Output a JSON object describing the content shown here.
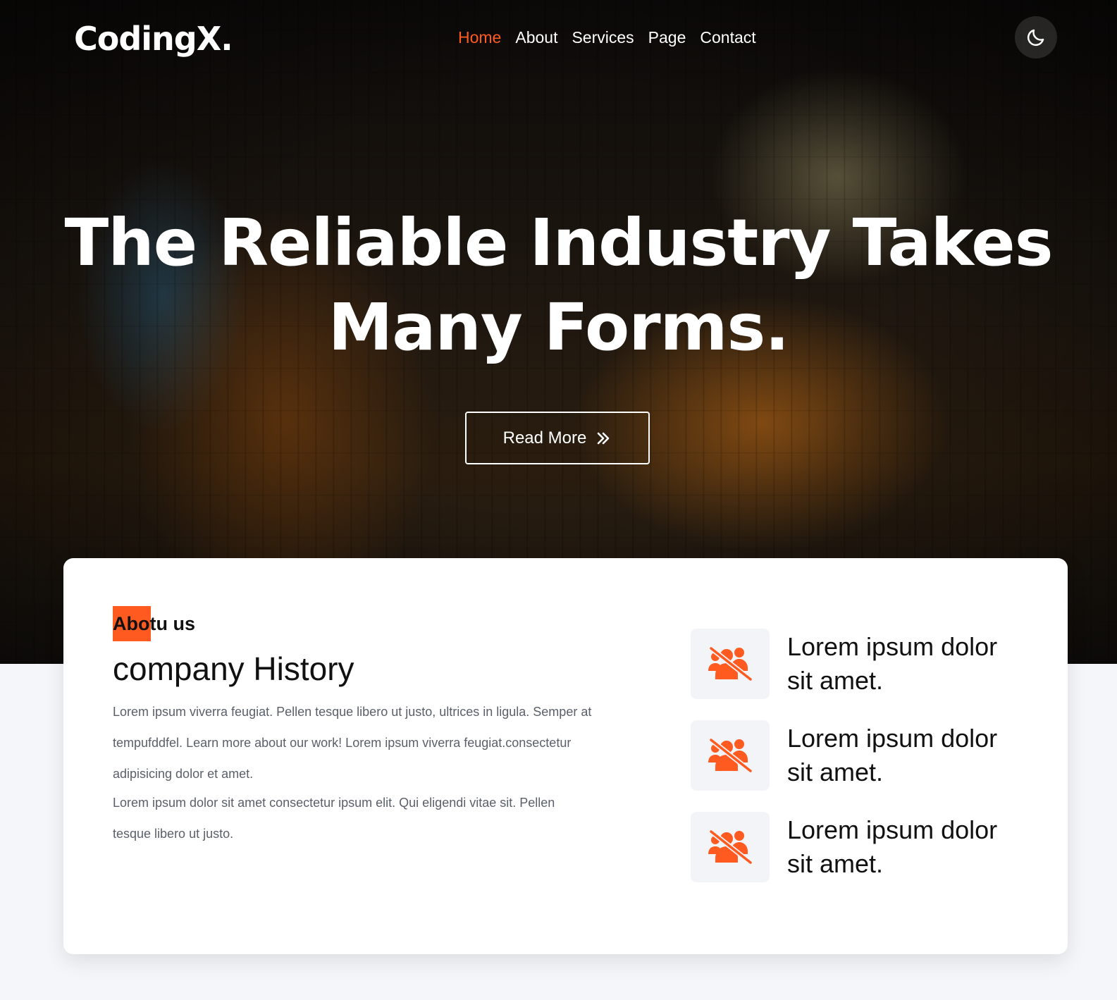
{
  "header": {
    "logo": "CodingX.",
    "nav": [
      {
        "label": "Home",
        "active": true
      },
      {
        "label": "About",
        "active": false
      },
      {
        "label": "Services",
        "active": false
      },
      {
        "label": "Page",
        "active": false
      },
      {
        "label": "Contact",
        "active": false
      }
    ],
    "theme_toggle_icon": "moon-icon"
  },
  "hero": {
    "title_line1": "The Reliable Industry Takes",
    "title_line2": "Many Forms.",
    "cta_label": "Read More",
    "cta_icon": "double-chevron-right-icon"
  },
  "about": {
    "tag": "Abotu us",
    "title": "company History",
    "paragraph1": "Lorem ipsum viverra feugiat. Pellen tesque libero ut justo, ultrices in ligula. Semper at tempufddfel. Learn more about our work! Lorem ipsum viverra feugiat.consectetur adipisicing dolor et amet.",
    "paragraph2": "Lorem ipsum dolor sit amet consectetur ipsum elit. Qui eligendi vitae sit. Pellen tesque libero ut justo.",
    "features": [
      {
        "icon": "people-slash-icon",
        "text": "Lorem ipsum dolor sit amet."
      },
      {
        "icon": "people-slash-icon",
        "text": "Lorem ipsum dolor sit amet."
      },
      {
        "icon": "people-slash-icon",
        "text": "Lorem ipsum dolor sit amet."
      }
    ]
  },
  "colors": {
    "accent": "#ff5a1f",
    "page_bg": "#f5f6fa",
    "card_bg": "#ffffff",
    "icon_box_bg": "#f3f4f8"
  }
}
